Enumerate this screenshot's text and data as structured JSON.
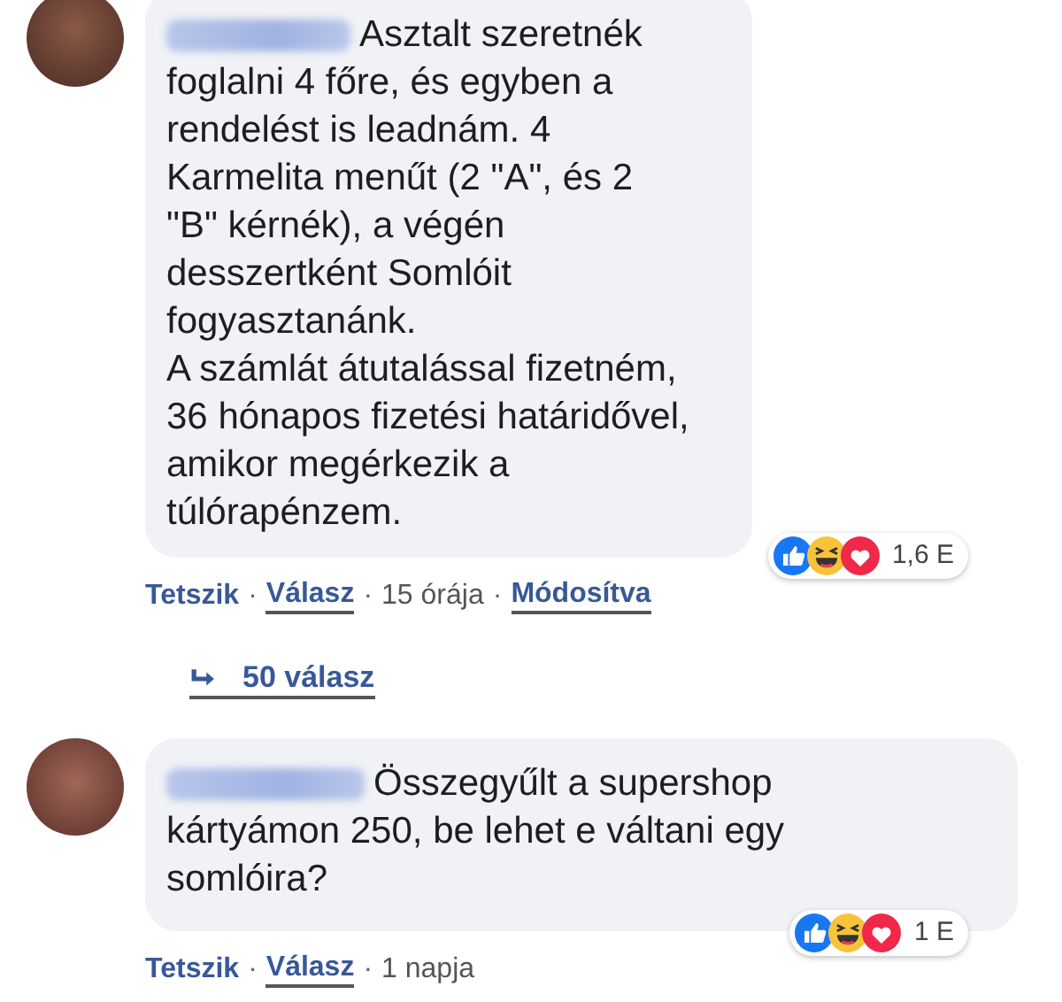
{
  "comments": [
    {
      "lines": [
        "Asztalt szeretnék",
        "foglalni 4 főre, és egyben a",
        "rendelést is leadnám. 4",
        "Karmelita menűt (2 \"A\", és 2",
        "\"B\" kérnék), a végén",
        "desszertként Somlóit",
        "fogyasztanánk.",
        "A számlát átutalással fizetném,",
        "36 hónapos fizetési határidővel,",
        "amikor megérkezik a",
        "túlórapénzem."
      ],
      "reaction_count": "1,6 E",
      "actions": [
        {
          "label": "Tetszik",
          "kind": "link"
        },
        {
          "label": "·",
          "kind": "separator"
        },
        {
          "label": "Válasz",
          "kind": "underlined"
        },
        {
          "label": "·",
          "kind": "separator"
        },
        {
          "label": "15 órája",
          "kind": "time"
        },
        {
          "label": "·",
          "kind": "separator"
        },
        {
          "label": "Módosítva",
          "kind": "underlined"
        }
      ],
      "replies": "50 válasz"
    },
    {
      "lines": [
        "Összegyűlt a supershop",
        "kártyámon 250, be lehet e váltani egy",
        "somlóira?"
      ],
      "reaction_count": "1 E",
      "actions": [
        {
          "label": "Tetszik",
          "kind": "link"
        },
        {
          "label": "·",
          "kind": "separator"
        },
        {
          "label": "Válasz",
          "kind": "underlined"
        },
        {
          "label": "·",
          "kind": "separator"
        },
        {
          "label": "1 napja",
          "kind": "time"
        }
      ]
    }
  ]
}
